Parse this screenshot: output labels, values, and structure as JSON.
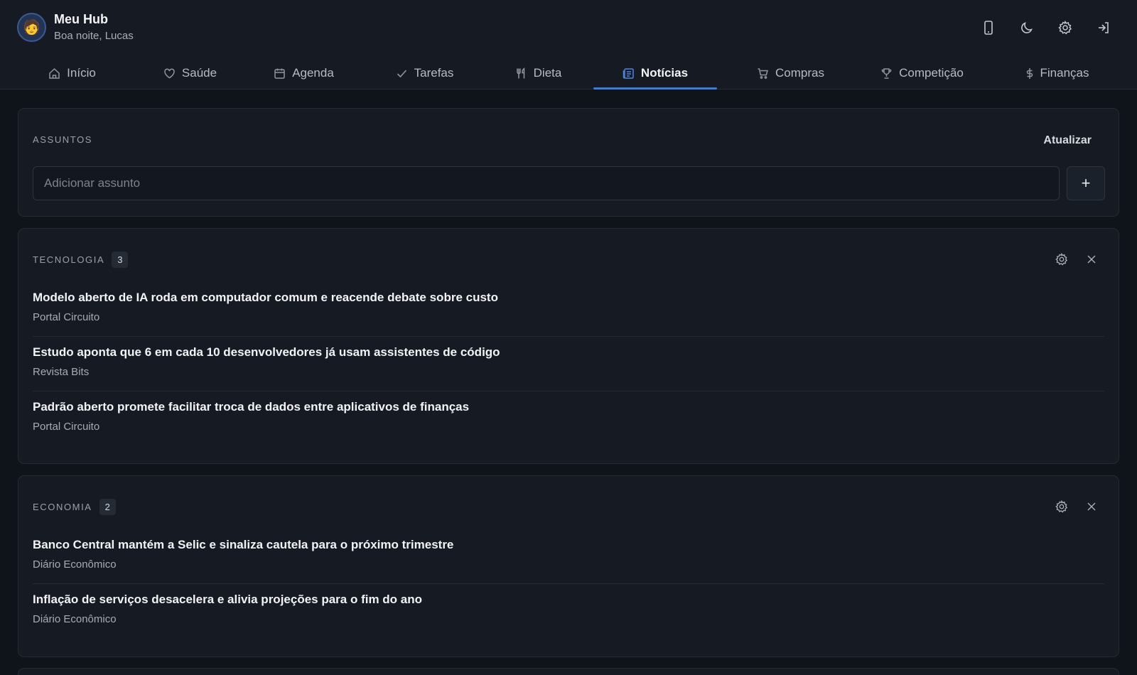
{
  "header": {
    "title": "Meu Hub",
    "greeting": "Boa noite, Lucas",
    "avatar": "🧑",
    "actions": [
      "phone-icon",
      "moon-icon",
      "gear-icon",
      "logout-icon"
    ]
  },
  "nav": {
    "tabs": [
      {
        "label": "Início",
        "icon": "home-icon",
        "active": false
      },
      {
        "label": "Saúde",
        "icon": "heart-icon",
        "active": false
      },
      {
        "label": "Agenda",
        "icon": "calendar-icon",
        "active": false
      },
      {
        "label": "Tarefas",
        "icon": "check-icon",
        "active": false
      },
      {
        "label": "Dieta",
        "icon": "utensils-icon",
        "active": false
      },
      {
        "label": "Notícias",
        "icon": "newspaper-icon",
        "active": true
      },
      {
        "label": "Compras",
        "icon": "cart-icon",
        "active": false
      },
      {
        "label": "Competição",
        "icon": "trophy-icon",
        "active": false
      },
      {
        "label": "Finanças",
        "icon": "dollar-icon",
        "active": false
      }
    ]
  },
  "subjects": {
    "label": "ASSUNTOS",
    "refresh_label": "Atualizar",
    "input_placeholder": "Adicionar assunto",
    "add_label": "+"
  },
  "sections": [
    {
      "name": "TECNOLOGIA",
      "count": "3",
      "items": [
        {
          "title": "Modelo aberto de IA roda em computador comum e reacende debate sobre custo",
          "source": "Portal Circuito"
        },
        {
          "title": "Estudo aponta que 6 em cada 10 desenvolvedores já usam assistentes de código",
          "source": "Revista Bits"
        },
        {
          "title": "Padrão aberto promete facilitar troca de dados entre aplicativos de finanças",
          "source": "Portal Circuito"
        }
      ]
    },
    {
      "name": "ECONOMIA",
      "count": "2",
      "items": [
        {
          "title": "Banco Central mantém a Selic e sinaliza cautela para o próximo trimestre",
          "source": "Diário Econômico"
        },
        {
          "title": "Inflação de serviços desacelera e alivia projeções para o fim do ano",
          "source": "Diário Econômico"
        }
      ]
    }
  ],
  "colors": {
    "background": "#0f131a",
    "surface": "#161b23",
    "accent": "#3d7be0"
  }
}
